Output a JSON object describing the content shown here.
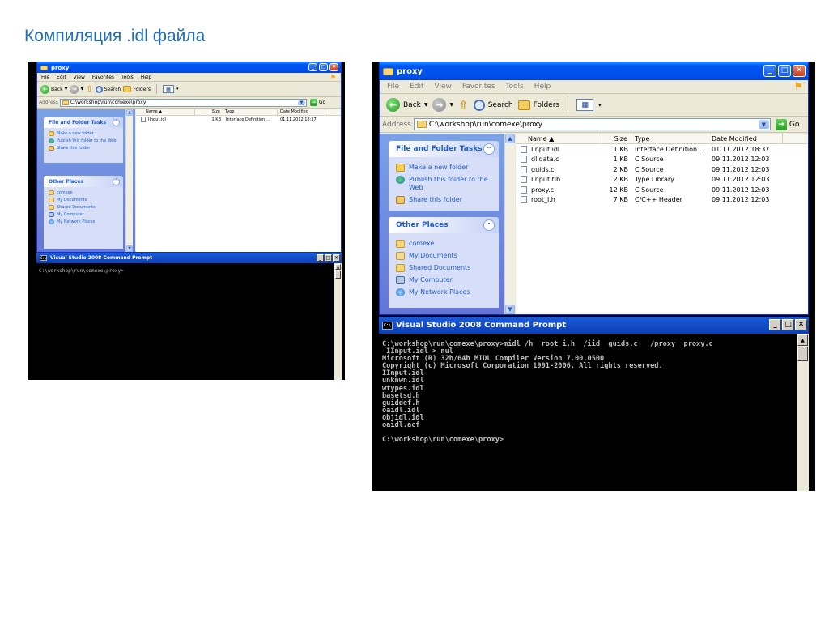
{
  "slide_title": "Компиляция .idl файла",
  "explorer": {
    "title": "proxy",
    "menu": [
      "File",
      "Edit",
      "View",
      "Favorites",
      "Tools",
      "Help"
    ],
    "toolbar": {
      "back": "Back",
      "search": "Search",
      "folders": "Folders"
    },
    "address_label": "Address",
    "address_value": "C:\\workshop\\run\\comexe\\proxy",
    "go_label": "Go",
    "tasks_title": "File and Folder Tasks",
    "tasks": [
      "Make a new folder",
      "Publish this folder to the Web",
      "Share this folder"
    ],
    "places_title": "Other Places",
    "places": [
      "comexe",
      "My Documents",
      "Shared Documents",
      "My Computer",
      "My Network Places"
    ],
    "columns": {
      "name": "Name",
      "size": "Size",
      "type": "Type",
      "date": "Date Modified"
    }
  },
  "left_files": [
    {
      "name": "IInput.idl",
      "size": "1 KB",
      "type": "Interface Definition ...",
      "date": "01.11.2012 18:37"
    }
  ],
  "right_files": [
    {
      "name": "IInput.idl",
      "size": "1 KB",
      "type": "Interface Definition ...",
      "date": "01.11.2012 18:37"
    },
    {
      "name": "dlldata.c",
      "size": "1 KB",
      "type": "C Source",
      "date": "09.11.2012 12:03"
    },
    {
      "name": "guids.c",
      "size": "2 KB",
      "type": "C Source",
      "date": "09.11.2012 12:03"
    },
    {
      "name": "IInput.tlb",
      "size": "2 KB",
      "type": "Type Library",
      "date": "09.11.2012 12:03"
    },
    {
      "name": "proxy.c",
      "size": "12 KB",
      "type": "C Source",
      "date": "09.11.2012 12:03"
    },
    {
      "name": "root_i.h",
      "size": "7 KB",
      "type": "C/C++ Header",
      "date": "09.11.2012 12:03"
    }
  ],
  "console": {
    "title": "Visual Studio 2008 Command Prompt",
    "left_lines": [
      "C:\\workshop\\run\\comexe\\proxy>"
    ],
    "right_lines": [
      "C:\\workshop\\run\\comexe\\proxy>midl /h  root_i.h  /iid  guids.c   /proxy  proxy.c",
      " IInput.idl > nul",
      "Microsoft (R) 32b/64b MIDL Compiler Version 7.00.0500",
      "Copyright (c) Microsoft Corporation 1991-2006. All rights reserved.",
      "IInput.idl",
      "unknwn.idl",
      "wtypes.idl",
      "basetsd.h",
      "guiddef.h",
      "oaidl.idl",
      "objidl.idl",
      "oaidl.acf",
      "",
      "C:\\workshop\\run\\comexe\\proxy>"
    ]
  }
}
